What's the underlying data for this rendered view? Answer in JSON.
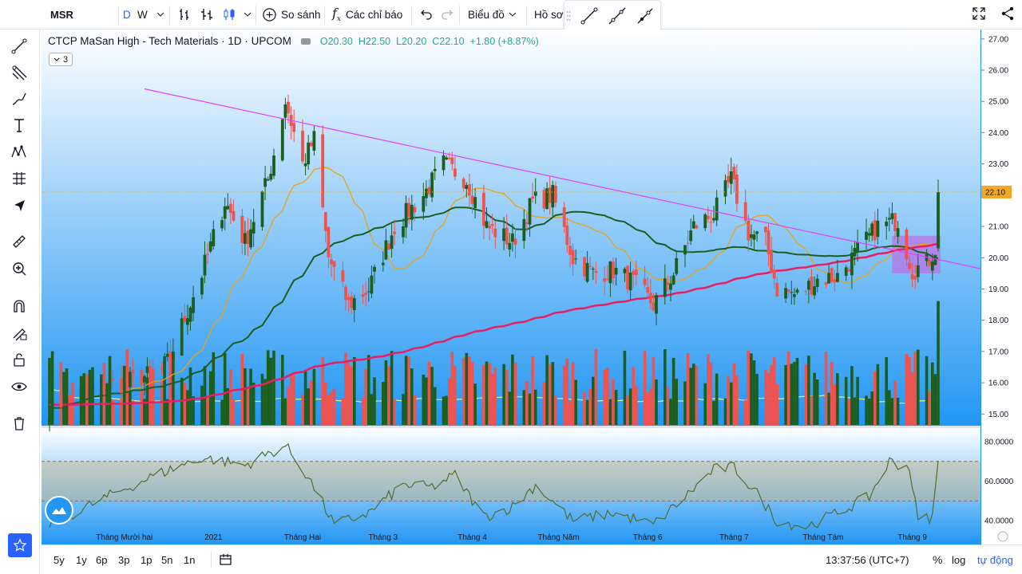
{
  "toolbar": {
    "symbol": "MSR",
    "interval_d": "D",
    "interval_w": "W",
    "compare_label": "So sánh",
    "indicators_label": "Các chỉ báo",
    "chart_type_label": "Biểu đồ",
    "profile_label": "Hồ sơ"
  },
  "legend": {
    "title": "CTCP MaSan High - Tech Materials · 1D · UPCOM",
    "open": "O20.30",
    "high": "H22.50",
    "low": "L20.20",
    "close": "C22.10",
    "change": "+1.80 (+8.87%)",
    "collapse_count": "3"
  },
  "bottom": {
    "ranges": [
      "5y",
      "1y",
      "6p",
      "3p",
      "1p",
      "5n",
      "1n"
    ],
    "clock": "13:37:56 (UTC+7)",
    "percent": "%",
    "log": "log",
    "auto": "tự động"
  },
  "colors": {
    "up": "#1b5e20",
    "down": "#ef5350",
    "up_volume": "#1b5e20",
    "down_volume": "#ef5350",
    "ma20": "#e8a317",
    "ma50": "#1b5e20",
    "ma200": "#e91e63",
    "trendline": "#e040fb",
    "rsi": "#556b2f",
    "last_price": "#f5a623",
    "background_top": "#ffffff",
    "background_bottom": "#2196f3"
  },
  "chart_data": {
    "type": "candlestick",
    "symbol": "MSR",
    "price_axis": {
      "ticks": [
        "27.00",
        "26.00",
        "25.00",
        "24.00",
        "23.00",
        "22.00",
        "21.00",
        "20.00",
        "19.00",
        "18.00",
        "17.00",
        "16.00",
        "15.00"
      ],
      "range": [
        14.6,
        27.3
      ],
      "last_price": "22.10"
    },
    "rsi_axis": {
      "ticks": [
        "80.0000",
        "60.0000",
        "40.0000"
      ],
      "range": [
        28,
        86
      ],
      "upper_band": 70,
      "lower_band": 50
    },
    "x_labels": [
      "Tháng Mười hai",
      "2021",
      "Tháng Hai",
      "Tháng 3",
      "Tháng 4",
      "Tháng Năm",
      "Tháng 6",
      "Tháng 7",
      "Tháng Tám",
      "Tháng 9"
    ],
    "x_label_dates": [
      "2020-12-01",
      "2021-01-01",
      "2021-02-01",
      "2021-03-01",
      "2021-04-01",
      "2021-05-01",
      "2021-06-01",
      "2021-07-01",
      "2021-08-01",
      "2021-09-01"
    ],
    "date_range": [
      "2020-11-05",
      "2021-09-10"
    ],
    "close_anchors": [
      [
        "2020-11-05",
        15.2
      ],
      [
        "2020-11-20",
        15.8
      ],
      [
        "2020-12-01",
        16.0
      ],
      [
        "2020-12-15",
        16.4
      ],
      [
        "2020-12-28",
        19.5
      ],
      [
        "2021-01-05",
        21.8
      ],
      [
        "2021-01-12",
        20.5
      ],
      [
        "2021-01-20",
        22.5
      ],
      [
        "2021-01-26",
        25.0
      ],
      [
        "2021-02-01",
        23.0
      ],
      [
        "2021-02-05",
        23.8
      ],
      [
        "2021-02-10",
        20.0
      ],
      [
        "2021-02-17",
        18.5
      ],
      [
        "2021-02-24",
        19.0
      ],
      [
        "2021-03-05",
        21.0
      ],
      [
        "2021-03-15",
        22.0
      ],
      [
        "2021-03-22",
        23.0
      ],
      [
        "2021-03-30",
        22.5
      ],
      [
        "2021-04-06",
        21.0
      ],
      [
        "2021-04-15",
        20.5
      ],
      [
        "2021-04-22",
        21.8
      ],
      [
        "2021-04-29",
        22.0
      ],
      [
        "2021-05-06",
        20.0
      ],
      [
        "2021-05-13",
        19.5
      ],
      [
        "2021-05-20",
        19.6
      ],
      [
        "2021-05-27",
        19.2
      ],
      [
        "2021-06-03",
        18.5
      ],
      [
        "2021-06-10",
        19.5
      ],
      [
        "2021-06-17",
        21.0
      ],
      [
        "2021-06-24",
        21.4
      ],
      [
        "2021-06-30",
        22.5
      ],
      [
        "2021-07-06",
        20.8
      ],
      [
        "2021-07-12",
        20.5
      ],
      [
        "2021-07-16",
        19.0
      ],
      [
        "2021-07-23",
        18.8
      ],
      [
        "2021-07-30",
        19.3
      ],
      [
        "2021-08-06",
        19.4
      ],
      [
        "2021-08-13",
        20.2
      ],
      [
        "2021-08-20",
        21.0
      ],
      [
        "2021-08-27",
        21.2
      ],
      [
        "2021-09-01",
        19.6
      ],
      [
        "2021-09-06",
        19.8
      ],
      [
        "2021-09-09",
        20.3
      ],
      [
        "2021-09-10",
        22.1
      ]
    ],
    "rsi_anchors": [
      [
        "2020-11-05",
        38
      ],
      [
        "2020-11-25",
        52
      ],
      [
        "2020-12-10",
        62
      ],
      [
        "2020-12-28",
        72
      ],
      [
        "2021-01-12",
        68
      ],
      [
        "2021-01-26",
        78
      ],
      [
        "2021-02-03",
        62
      ],
      [
        "2021-02-12",
        38
      ],
      [
        "2021-02-24",
        44
      ],
      [
        "2021-03-08",
        58
      ],
      [
        "2021-03-18",
        57
      ],
      [
        "2021-03-26",
        63
      ],
      [
        "2021-04-05",
        42
      ],
      [
        "2021-04-15",
        47
      ],
      [
        "2021-04-23",
        58
      ],
      [
        "2021-05-06",
        40
      ],
      [
        "2021-05-20",
        44
      ],
      [
        "2021-06-03",
        38
      ],
      [
        "2021-06-14",
        52
      ],
      [
        "2021-06-24",
        66
      ],
      [
        "2021-07-01",
        67
      ],
      [
        "2021-07-10",
        52
      ],
      [
        "2021-07-16",
        40
      ],
      [
        "2021-07-26",
        37
      ],
      [
        "2021-08-06",
        44
      ],
      [
        "2021-08-17",
        52
      ],
      [
        "2021-08-24",
        70
      ],
      [
        "2021-08-31",
        67
      ],
      [
        "2021-09-03",
        40
      ],
      [
        "2021-09-08",
        42
      ],
      [
        "2021-09-10",
        69
      ]
    ],
    "volume_scale": "relative",
    "overlays": {
      "ma20": "MA20",
      "ma50": "MA50",
      "ma200": "MA200",
      "trendline": [
        [
          "2020-12-08",
          25.4
        ],
        [
          "2021-09-10",
          19.8
        ]
      ],
      "shaded_box": {
        "from": "2021-08-25",
        "to": "2021-09-10",
        "low": 19.5,
        "high": 20.7
      }
    }
  }
}
